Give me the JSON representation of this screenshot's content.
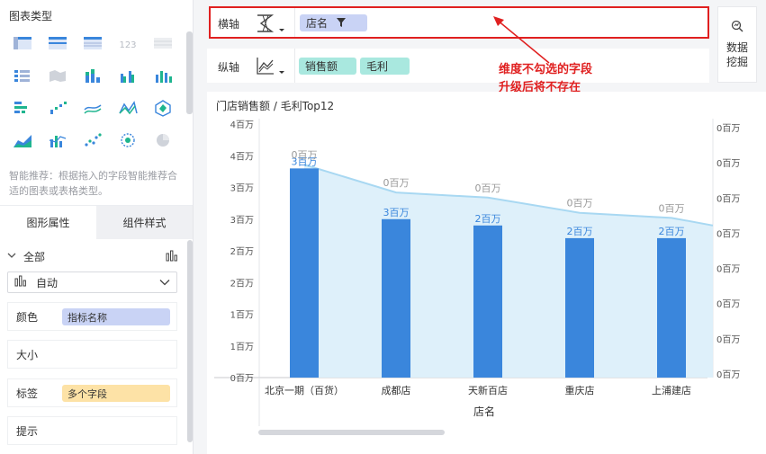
{
  "left": {
    "section_title": "图表类型",
    "chart_types": [
      {
        "icon": "cross-table-icon"
      },
      {
        "icon": "group-table-icon"
      },
      {
        "icon": "detail-table-icon"
      },
      {
        "icon": "kpi-number-icon",
        "text": "123"
      },
      {
        "icon": "disabled-table-icon"
      },
      {
        "icon": "kpi-list-icon"
      },
      {
        "icon": "map-disabled-icon"
      },
      {
        "icon": "stacked-bar-icon"
      },
      {
        "icon": "grouped-bar-icon"
      },
      {
        "icon": "column-bar-icon"
      },
      {
        "icon": "horizontal-bar-icon"
      },
      {
        "icon": "waterfall-icon"
      },
      {
        "icon": "line-icon"
      },
      {
        "icon": "radar-icon"
      },
      {
        "icon": "polygon-icon"
      },
      {
        "icon": "area-icon"
      },
      {
        "icon": "combo-bar-line-icon"
      },
      {
        "icon": "scatter-icon"
      },
      {
        "icon": "bubble-icon"
      },
      {
        "icon": "pie-icon"
      }
    ],
    "hint": "智能推荐：根据拖入的字段智能推荐合适的图表或表格类型。",
    "tabs": [
      "图形属性",
      "组件样式"
    ],
    "all_label": "全部",
    "select_value": "自动",
    "props": [
      {
        "label": "颜色",
        "pill": "指标名称",
        "pill_color": "#c9d3f5"
      },
      {
        "label": "大小"
      },
      {
        "label": "标签",
        "pill": "多个字段",
        "pill_color": "#fde2a6"
      },
      {
        "label": "提示"
      }
    ]
  },
  "toolbar": {
    "x_label": "横轴",
    "y_label": "纵轴",
    "x_fields": [
      {
        "name": "店名",
        "color": "#c9d3f5"
      }
    ],
    "y_fields": [
      {
        "name": "销售额",
        "color": "#a9e8df"
      },
      {
        "name": "毛利",
        "color": "#a9e8df"
      }
    ],
    "mining_line1": "数据",
    "mining_line2": "挖掘"
  },
  "annotation": {
    "line1": "维度不勾选的字段",
    "line2": "升级后将不存在"
  },
  "card_title": "门店销售额 / 毛利Top12",
  "chart_data": {
    "type": "bar",
    "xlabel": "店名",
    "categories": [
      "北京一期（百货）",
      "成都店",
      "天新百店",
      "重庆店",
      "上浦建店"
    ],
    "left_ticks": [
      "0百万",
      "1百万",
      "1百万",
      "2百万",
      "2百万",
      "3百万",
      "3百万",
      "4百万",
      "4百万"
    ],
    "right_ticks": [
      "0百万",
      "0百万",
      "0百万",
      "0百万",
      "0百万",
      "0百万",
      "0百万",
      "0百万"
    ],
    "bar_values": [
      3.3,
      2.5,
      2.4,
      2.2,
      2.2
    ],
    "bar_labels": [
      "3百万",
      "3百万",
      "2百万",
      "2百万",
      "2百万"
    ],
    "area_labels": [
      "0百万",
      "0百万",
      "0百万",
      "0百万",
      "0百万"
    ],
    "area_values_rel": [
      0.84,
      0.73,
      0.71,
      0.65,
      0.63,
      0.6
    ],
    "series": [
      {
        "name": "销售额",
        "color": "#3a86dc"
      },
      {
        "name": "毛利",
        "color": "#a8d8f2"
      }
    ]
  }
}
